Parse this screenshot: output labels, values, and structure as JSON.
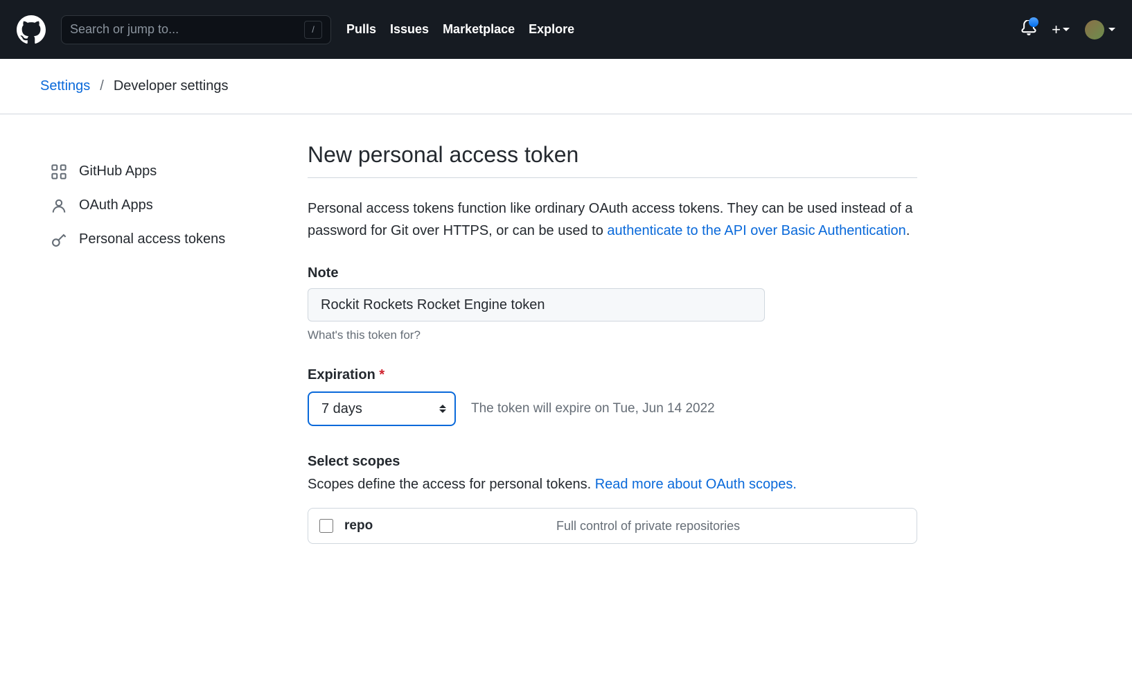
{
  "header": {
    "search_placeholder": "Search or jump to...",
    "slash_key": "/",
    "nav": [
      "Pulls",
      "Issues",
      "Marketplace",
      "Explore"
    ]
  },
  "breadcrumb": {
    "link": "Settings",
    "separator": "/",
    "current": "Developer settings"
  },
  "sidebar": {
    "items": [
      {
        "label": "GitHub Apps"
      },
      {
        "label": "OAuth Apps"
      },
      {
        "label": "Personal access tokens"
      }
    ]
  },
  "main": {
    "title": "New personal access token",
    "description_pre": "Personal access tokens function like ordinary OAuth access tokens. They can be used instead of a password for Git over HTTPS, or can be used to ",
    "description_link": "authenticate to the API over Basic Authentication",
    "description_post": ".",
    "note_label": "Note",
    "note_value": "Rockit Rockets Rocket Engine token",
    "note_hint": "What's this token for?",
    "expiration_label": "Expiration",
    "expiration_value": "7 days",
    "expiration_text": "The token will expire on Tue, Jun 14 2022",
    "scopes_label": "Select scopes",
    "scopes_desc_pre": "Scopes define the access for personal tokens. ",
    "scopes_desc_link": "Read more about OAuth scopes.",
    "scopes": [
      {
        "name": "repo",
        "desc": "Full control of private repositories"
      }
    ]
  }
}
